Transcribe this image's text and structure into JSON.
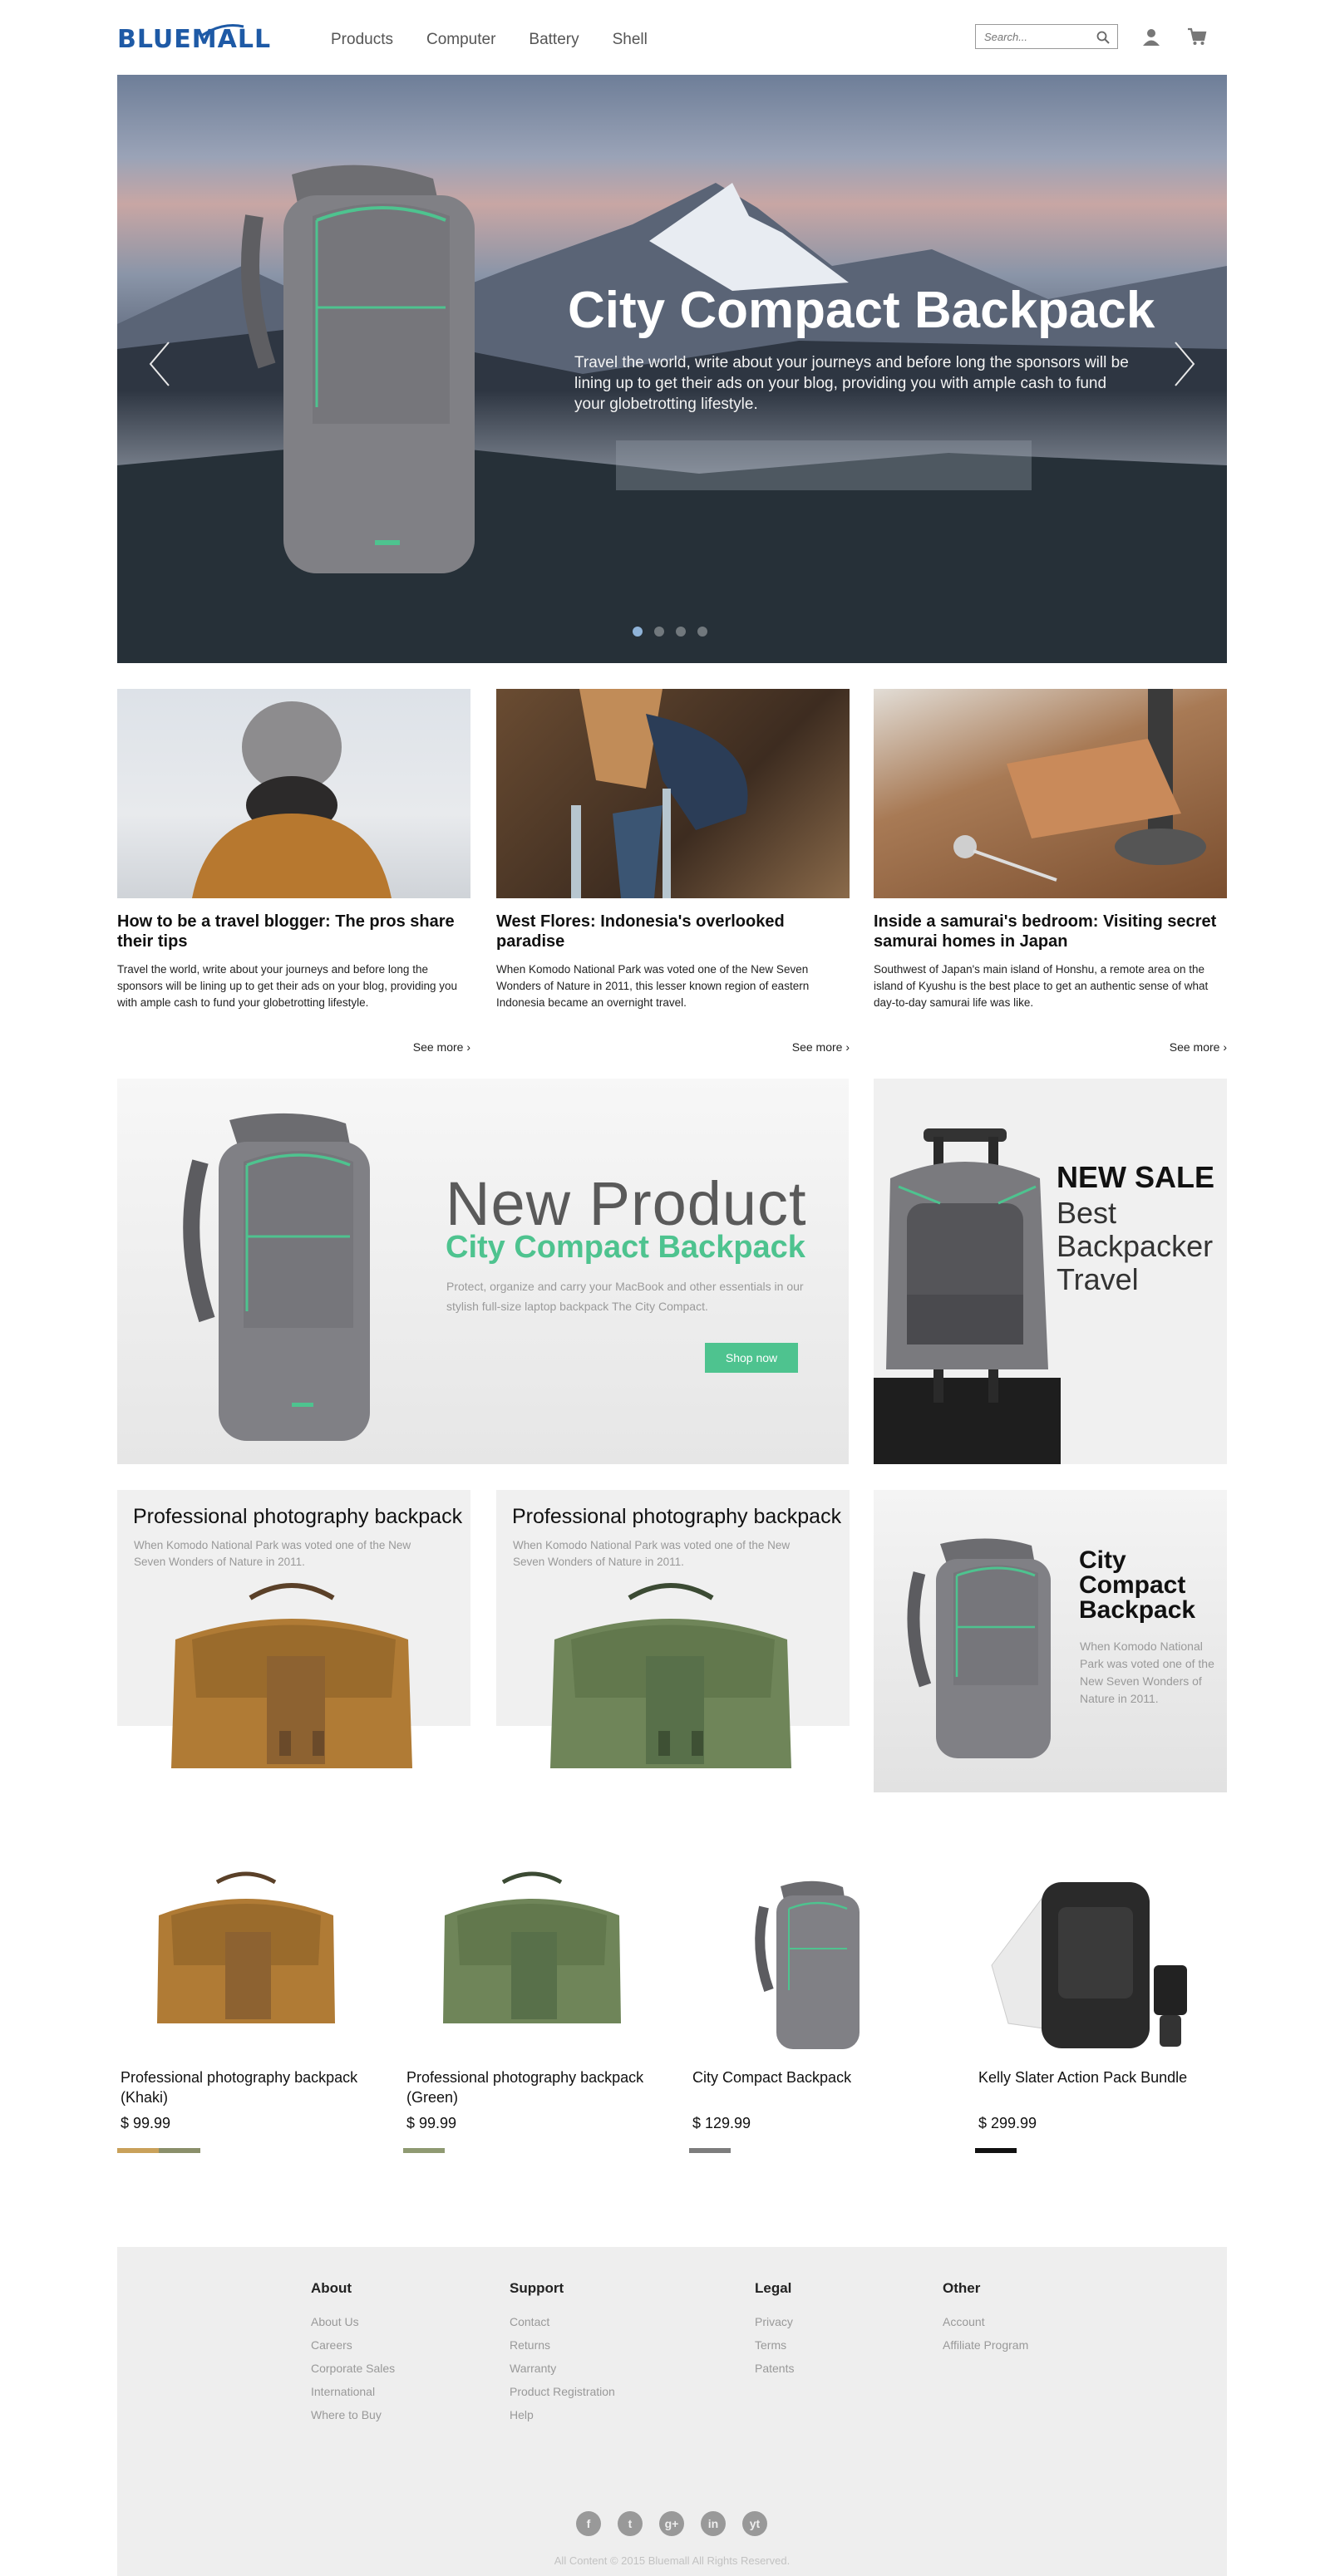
{
  "header": {
    "logo_part1": "BLUE",
    "logo_part2": "MALL",
    "nav": [
      "Products",
      "Computer",
      "Battery",
      "Shell"
    ],
    "search_placeholder": "Search..."
  },
  "hero": {
    "title": "City Compact Backpack",
    "description": "Travel the world, write about your journeys and before long the sponsors will be lining up to get their ads on your blog, providing you with ample cash to fund your globetrotting lifestyle.",
    "slides": 4,
    "active_slide": 1
  },
  "articles": [
    {
      "title": "How to be a travel blogger: The pros share their tips",
      "text": "Travel the world, write about your journeys and before long the sponsors will be lining up to get their ads on your blog, providing you with ample cash to fund your globetrotting lifestyle.",
      "more": "See more"
    },
    {
      "title": "West Flores: Indonesia's overlooked paradise",
      "text": "When Komodo National Park was voted one of the New Seven Wonders of Nature in 2011, this lesser known region of eastern Indonesia became an overnight travel.",
      "more": "See more"
    },
    {
      "title": "Inside a samurai's bedroom: Visiting secret samurai homes in Japan",
      "text": "Southwest of Japan's main island of Honshu, a remote area on the island of Kyushu is the best place to get an authentic sense of what day-to-day samurai life was like.",
      "more": "See more"
    }
  ],
  "promo": {
    "new_label": "New Product",
    "product_name": "City Compact Backpack",
    "description": "Protect, organize and carry your MacBook and other essentials in our stylish full-size laptop backpack The City Compact.",
    "button": "Shop now"
  },
  "sale": {
    "title": "NEW SALE",
    "subtitle": "Best Backpacker Travel"
  },
  "features": [
    {
      "title": "Professional photography backpack",
      "text": "When Komodo National Park was voted one of the New Seven Wonders of Nature in 2011."
    },
    {
      "title": "Professional photography backpack",
      "text": "When Komodo National Park was voted one of the New Seven Wonders of Nature in 2011."
    },
    {
      "title": "City Compact Backpack",
      "text": "When Komodo National Park was voted one of the New Seven Wonders of Nature in 2011."
    }
  ],
  "products": [
    {
      "name": "Professional photography backpack (Khaki)",
      "price": "$ 99.99",
      "colors": [
        "#c9a15a",
        "#8a8f6a"
      ]
    },
    {
      "name": "Professional photography backpack (Green)",
      "price": "$ 99.99",
      "colors": [
        "#8f9a72"
      ]
    },
    {
      "name": "City  Compact  Backpack",
      "price": "$ 129.99",
      "colors": [
        "#7d7d7d"
      ]
    },
    {
      "name": "Kelly Slater Action Pack Bundle",
      "price": "$ 299.99",
      "colors": [
        "#111111"
      ]
    }
  ],
  "footer": {
    "columns": [
      {
        "title": "About",
        "links": [
          "About Us",
          "Careers",
          "Corporate Sales",
          "International",
          "Where to Buy"
        ]
      },
      {
        "title": "Support",
        "links": [
          "Contact",
          "Returns",
          "Warranty",
          "Product Registration",
          "Help"
        ]
      },
      {
        "title": "Legal",
        "links": [
          "Privacy",
          "Terms",
          "Patents"
        ]
      },
      {
        "title": "Other",
        "links": [
          "Account",
          "Affiliate Program"
        ]
      }
    ],
    "socials": [
      "f",
      "t",
      "g+",
      "in",
      "yt"
    ],
    "copyright": "All Content © 2015 Bluemall All Rights Reserved."
  },
  "colors": {
    "brand": "#1e5aa6",
    "accent": "#4ec38f"
  }
}
